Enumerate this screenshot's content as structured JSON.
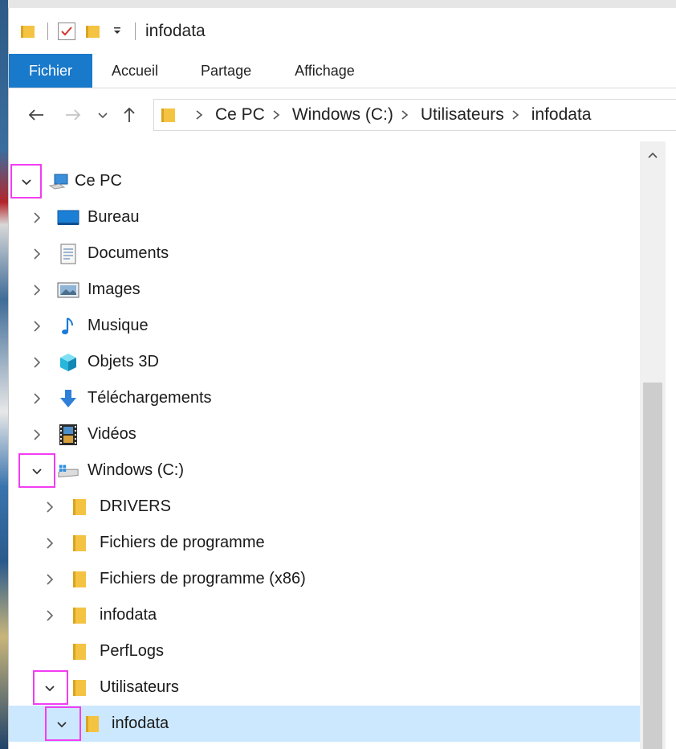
{
  "window": {
    "title": "infodata"
  },
  "ribbon": {
    "tabs": [
      {
        "label": "Fichier",
        "active": true
      },
      {
        "label": "Accueil"
      },
      {
        "label": "Partage"
      },
      {
        "label": "Affichage"
      }
    ]
  },
  "address": {
    "crumbs": [
      "Ce PC",
      "Windows (C:)",
      "Utilisateurs",
      "infodata"
    ]
  },
  "tree": {
    "ce_pc": "Ce PC",
    "bureau": "Bureau",
    "documents": "Documents",
    "images": "Images",
    "musique": "Musique",
    "objets3d": "Objets 3D",
    "telechargements": "Téléchargements",
    "videos": "Vidéos",
    "windows_c": "Windows (C:)",
    "drivers": "DRIVERS",
    "fichiers_programme": "Fichiers de programme",
    "fichiers_programme_x86": "Fichiers de programme (x86)",
    "infodata_c": "infodata",
    "perflogs": "PerfLogs",
    "utilisateurs": "Utilisateurs",
    "infodata_user": "infodata"
  },
  "colors": {
    "file_tab": "#1979ca",
    "selection": "#cce8ff",
    "highlight_box": "#f23df2",
    "folder": "#f5c342"
  }
}
